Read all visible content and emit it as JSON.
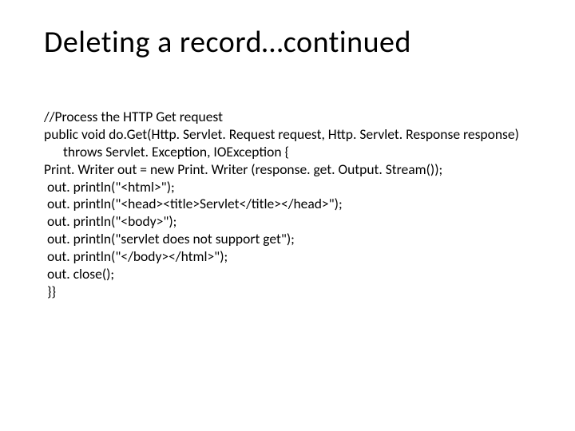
{
  "title": "Deleting a record…continued",
  "code": {
    "l1": "//Process the HTTP Get request",
    "l2": "public void do.Get(Http. Servlet. Request request, Http. Servlet. Response response) throws Servlet. Exception, IOException {",
    "l3": "Print. Writer out = new Print. Writer (response. get. Output. Stream());",
    "l4": " out. println(\"<html>\");",
    "l5": " out. println(\"<head><title>Servlet</title></head>\");",
    "l6": " out. println(\"<body>\");",
    "l7": " out. println(\"servlet does not support get\");",
    "l8": " out. println(\"</body></html>\");",
    "l9": " out. close();",
    "l10": " }}"
  }
}
